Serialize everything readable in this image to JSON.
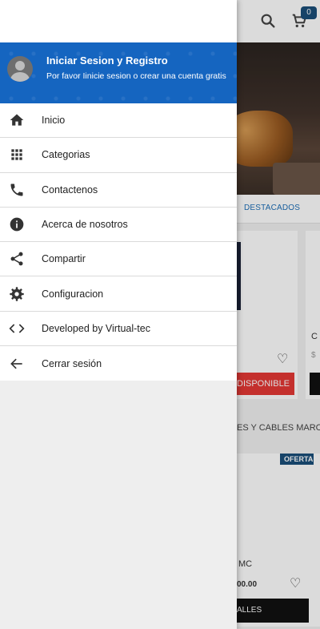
{
  "background_app": {
    "cart_count": "0",
    "tab_label": "DESTACADOS",
    "card1_button": "DISPONIBLE",
    "card2_letter": "C",
    "card2_price": "$",
    "section_title": "ES Y CABLES MARCA",
    "card3_badge": "OFERTA",
    "card3_name": "MC",
    "card3_price": "00.00",
    "card3_button": "ALLES"
  },
  "drawer": {
    "header": {
      "title": "Iniciar Sesion y Registro",
      "subtitle": "Por favor Iinicie sesion o crear una cuenta gratis",
      "color": "#1565c0"
    },
    "items": [
      {
        "label": "Inicio",
        "icon": "home-icon"
      },
      {
        "label": "Categorias",
        "icon": "grid-icon"
      },
      {
        "label": "Contactenos",
        "icon": "phone-icon"
      },
      {
        "label": "Acerca de nosotros",
        "icon": "info-icon"
      },
      {
        "label": "Compartir",
        "icon": "share-icon"
      },
      {
        "label": "Configuracion",
        "icon": "gear-icon"
      },
      {
        "label": "Developed by Virtual-tec",
        "icon": "code-icon"
      },
      {
        "label": "Cerrar sesión",
        "icon": "arrow-back-icon"
      }
    ]
  }
}
